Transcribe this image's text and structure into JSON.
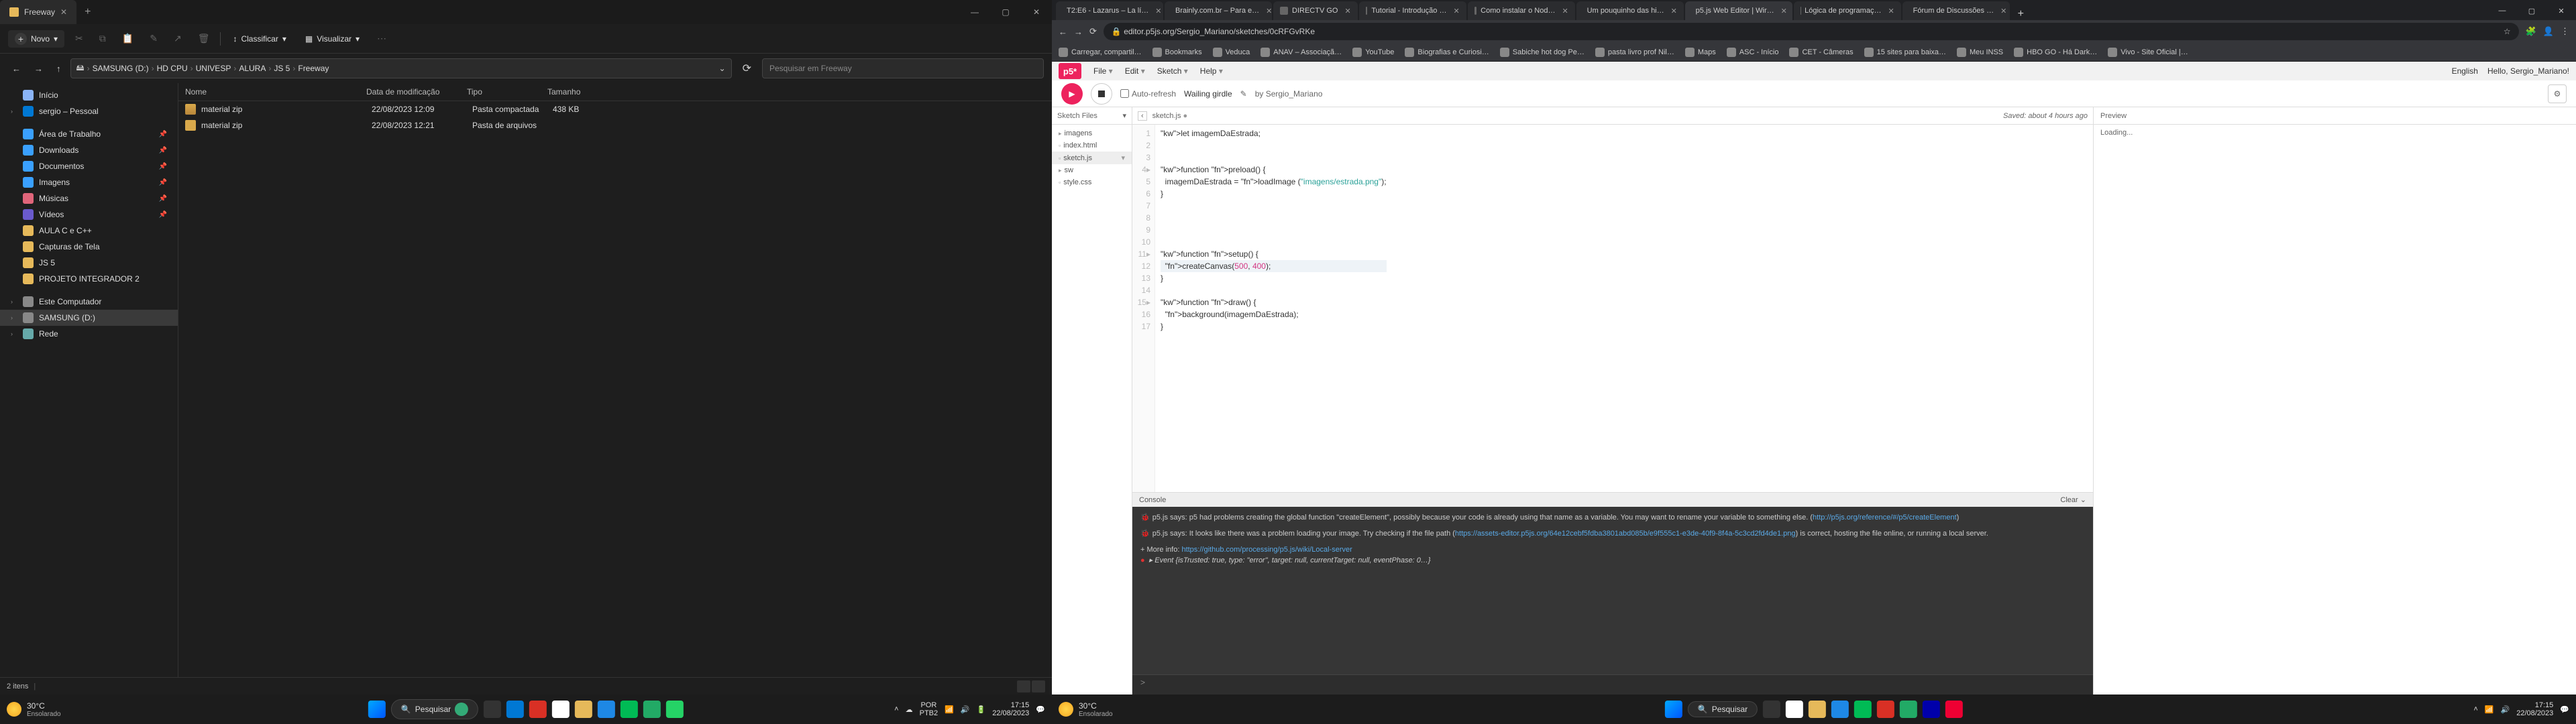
{
  "explorer": {
    "tab_title": "Freeway",
    "toolbar": {
      "new": "Novo",
      "sort": "Classificar",
      "view": "Visualizar"
    },
    "breadcrumb": [
      "SAMSUNG (D:)",
      "HD CPU",
      "UNIVESP",
      "ALURA",
      "JS 5",
      "Freeway"
    ],
    "search_placeholder": "Pesquisar em Freeway",
    "sidebar": {
      "home": "Início",
      "onedrive": "sergio – Pessoal",
      "desktop": "Área de Trabalho",
      "downloads": "Downloads",
      "documents": "Documentos",
      "pictures": "Imagens",
      "music": "Músicas",
      "videos": "Vídeos",
      "aula": "AULA C e C++",
      "capturas": "Capturas de Tela",
      "js5": "JS 5",
      "proj": "PROJETO INTEGRADOR 2",
      "thispc": "Este Computador",
      "samsung": "SAMSUNG (D:)",
      "network": "Rede"
    },
    "columns": {
      "name": "Nome",
      "date": "Data de modificação",
      "type": "Tipo",
      "size": "Tamanho"
    },
    "rows": [
      {
        "name": "material zip",
        "date": "22/08/2023 12:09",
        "type": "Pasta compactada",
        "size": "438 KB"
      },
      {
        "name": "material zip",
        "date": "22/08/2023 12:21",
        "type": "Pasta de arquivos",
        "size": ""
      }
    ],
    "status": "2 itens"
  },
  "taskbar_left": {
    "temp": "30°C",
    "cond": "Ensolarado",
    "search": "Pesquisar",
    "lang1": "POR",
    "lang2": "PTB2",
    "time": "17:15",
    "date": "22/08/2023"
  },
  "browser": {
    "tabs": [
      "T2:E6 - Lazarus – La lí…",
      "Brainly.com.br – Para e…",
      "DIRECTV GO",
      "Tutorial - Introdução …",
      "Como instalar o Nod…",
      "Um pouquinho das hi…",
      "p5.js Web Editor | Wir…",
      "Lógica de programaç…",
      "Fórum de Discussões …"
    ],
    "active_tab_index": 6,
    "url": "editor.p5js.org/Sergio_Mariano/sketches/0cRFGvRKe",
    "bookmarks": [
      "Carregar, compartil…",
      "Bookmarks",
      "Veduca",
      "ANAV – Associaçã…",
      "YouTube",
      "Biografias e Curiosi…",
      "Sabiche hot dog Pe…",
      "pasta livro prof Nil…",
      "Maps",
      "ASC - Início",
      "CET - Câmeras",
      "15 sites para baixa…",
      "Meu INSS",
      "HBO GO - Há Dark…",
      "Vivo - Site Oficial |…"
    ]
  },
  "p5": {
    "logo": "p5*",
    "menus": [
      "File",
      "Edit",
      "Sketch",
      "Help"
    ],
    "lang": "English",
    "hello": "Hello, Sergio_Mariano!",
    "autorefresh": "Auto-refresh",
    "sketch_name": "Wailing girdle",
    "by": "by Sergio_Mariano",
    "sketch_files_label": "Sketch Files",
    "files": [
      "imagens",
      "index.html",
      "sketch.js",
      "sw",
      "style.css"
    ],
    "active_file": "sketch.js",
    "tab_label": "sketch.js",
    "tab_dirty": "●",
    "saved": "Saved: about 4 hours ago",
    "preview_label": "Preview",
    "preview_status": "Loading...",
    "gutter": " 1\n 2\n 3\n 4▸\n 5\n 6\n 7\n 8\n 9\n10\n11▸\n12\n13\n14\n15▸\n16\n17\n",
    "code_lines": [
      {
        "t": "let imagemDaEstrada;",
        "cls": ""
      },
      {
        "t": "",
        "cls": ""
      },
      {
        "t": "",
        "cls": ""
      },
      {
        "t": "function preload() {",
        "cls": "fnline"
      },
      {
        "t": "  imagemDaEstrada = loadImage (\"imagens/estrada.png\");",
        "cls": ""
      },
      {
        "t": "}",
        "cls": ""
      },
      {
        "t": "",
        "cls": ""
      },
      {
        "t": "",
        "cls": ""
      },
      {
        "t": "",
        "cls": ""
      },
      {
        "t": "",
        "cls": ""
      },
      {
        "t": "function setup() {",
        "cls": "fnline"
      },
      {
        "t": "  createCanvas(500, 400);",
        "cls": "hl"
      },
      {
        "t": "}",
        "cls": ""
      },
      {
        "t": "",
        "cls": ""
      },
      {
        "t": "function draw() {",
        "cls": "fnline"
      },
      {
        "t": "  background(imagemDaEstrada);",
        "cls": ""
      },
      {
        "t": "}",
        "cls": ""
      }
    ],
    "console_label": "Console",
    "clear_label": "Clear",
    "console": {
      "msg1": "p5.js says: p5 had problems creating the global function \"createElement\", possibly because your code is already using that name as a variable. You may want to rename your variable to something else. (",
      "link1": "http://p5js.org/reference/#/p5/createElement",
      "msg1b": ")",
      "msg2": "p5.js says: It looks like there was a problem loading your image. Try checking if the file path (",
      "link2": "https://assets-editor.p5js.org/64e12cebf5fdba3801abd085b/e9f555c1-e3de-40f9-8f4a-5c3cd2fd4de1.png",
      "msg2b": ") is correct, hosting the file online, or running a local server.",
      "more": "+ More info: ",
      "morelink": "https://github.com/processing/p5.js/wiki/Local-server",
      "event": "▸ Event {isTrusted: true, type: \"error\", target: null, currentTarget: null, eventPhase: 0…}"
    },
    "repl_prompt": ">"
  },
  "taskbar_right": {
    "temp": "30°C",
    "cond": "Ensolarado",
    "search": "Pesquisar",
    "time": "17:15",
    "date": "22/08/2023"
  }
}
